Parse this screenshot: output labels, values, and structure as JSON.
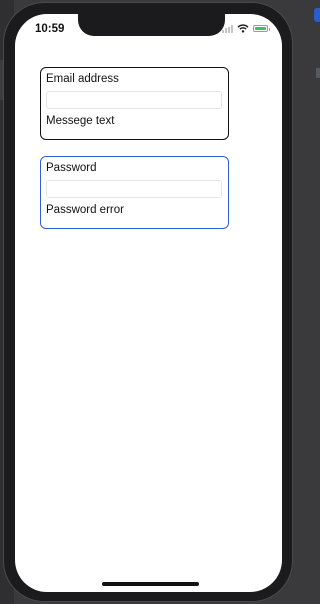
{
  "status_bar": {
    "time": "10:59",
    "icons": [
      "signal-icon",
      "wifi-icon",
      "battery-icon"
    ],
    "battery_color": "#34c759"
  },
  "email": {
    "label": "Email address",
    "value": "",
    "placeholder": "",
    "message": "Messege text",
    "border_color": "#111111"
  },
  "password": {
    "label": "Password",
    "value": "",
    "placeholder": "",
    "message": "Password error",
    "border_color": "#2f5fd8"
  }
}
